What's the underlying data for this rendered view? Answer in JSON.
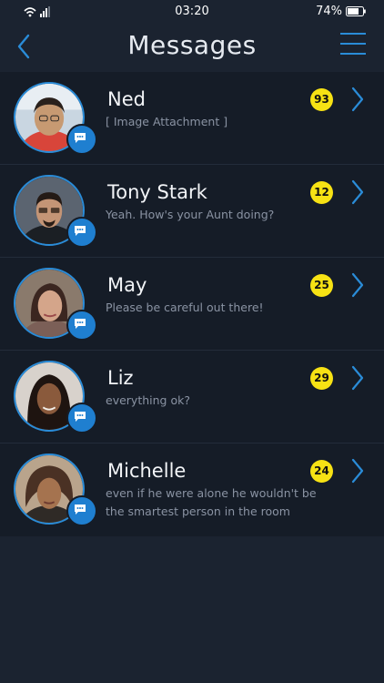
{
  "status_bar": {
    "time": "03:20",
    "battery": "74%",
    "icons": [
      "wifi-icon",
      "signal-icon",
      "battery-icon"
    ]
  },
  "header": {
    "title": "Messages",
    "back_icon": "chevron-left-icon",
    "menu_icon": "hamburger-menu-icon"
  },
  "colors": {
    "accent": "#2a8cd8",
    "badge": "#f7e214",
    "background": "#1b2330",
    "list_background": "#151c27"
  },
  "conversations": [
    {
      "name": "Ned",
      "preview": "[ Image Attachment ]",
      "count": "93"
    },
    {
      "name": "Tony Stark",
      "preview": "Yeah. How's your Aunt doing?",
      "count": "12"
    },
    {
      "name": "May",
      "preview": "Please be careful out there!",
      "count": "25"
    },
    {
      "name": "Liz",
      "preview": "everything ok?",
      "count": "29"
    },
    {
      "name": "Michelle",
      "preview": "even if he were alone he wouldn't be the smartest person in the room",
      "count": "24"
    }
  ]
}
